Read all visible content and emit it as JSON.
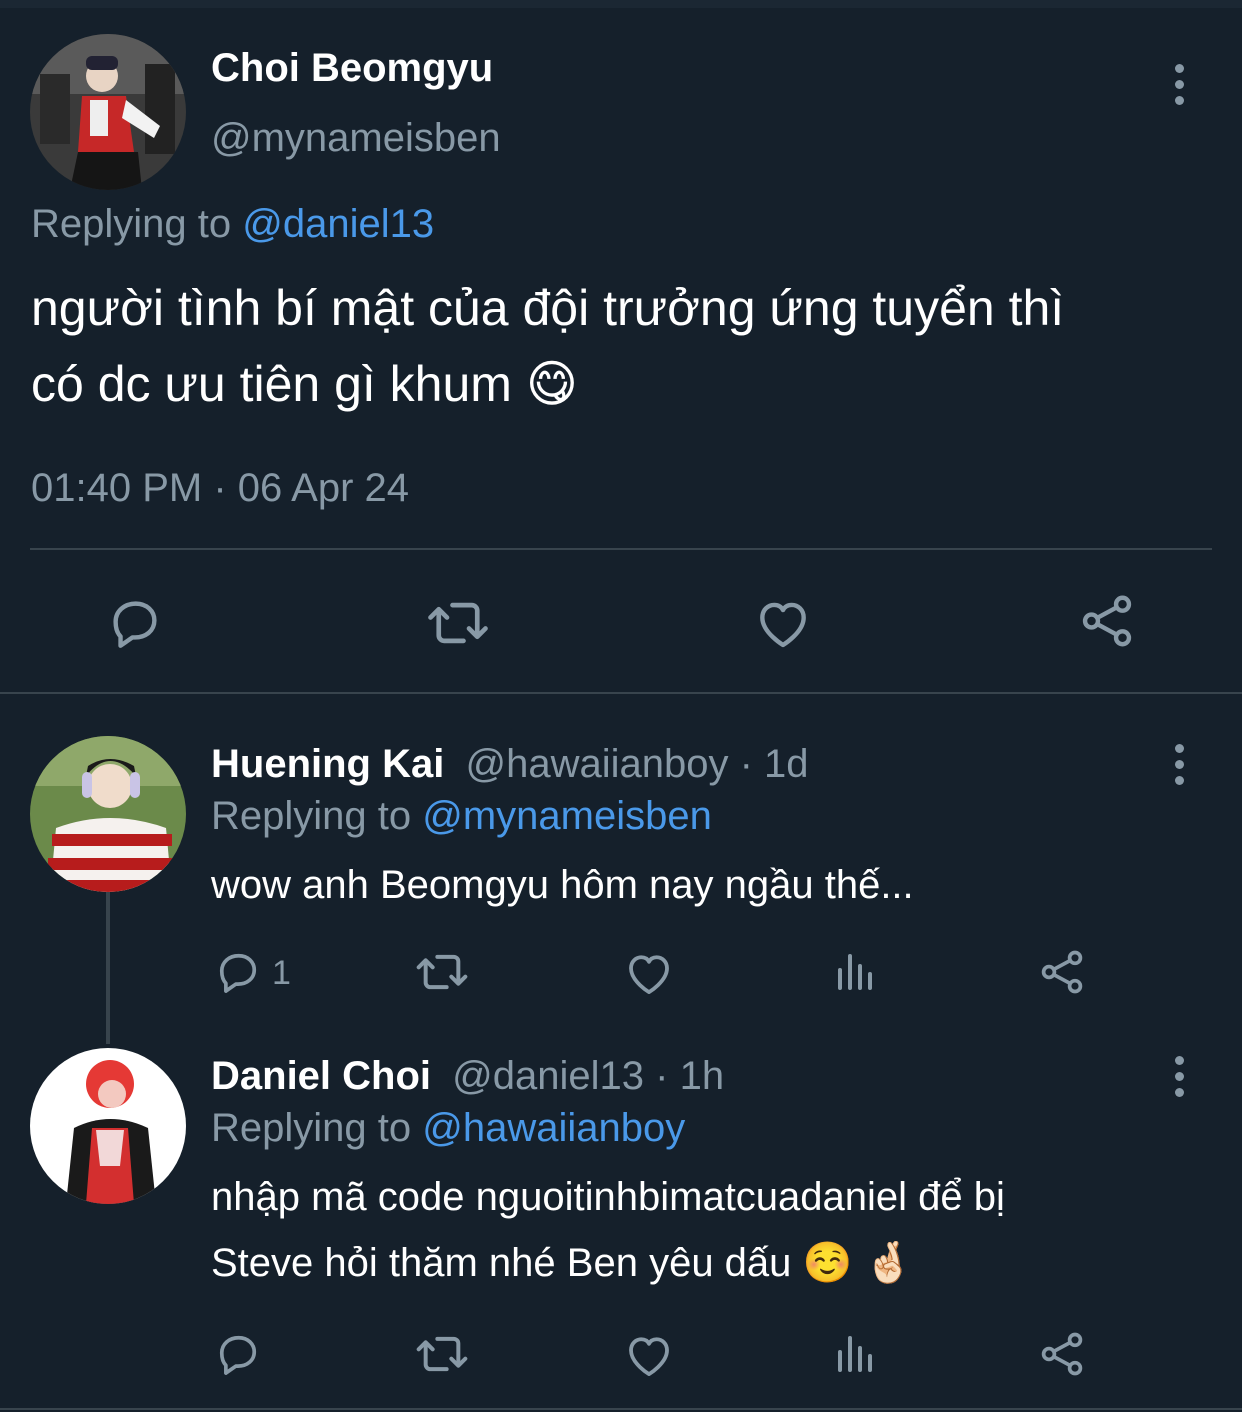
{
  "main_tweet": {
    "author_name": "Choi Beomgyu",
    "author_handle": "@mynameisben",
    "replying_prefix": "Replying to ",
    "replying_to": "@daniel13",
    "text_line1": "người tình bí mật của đội trưởng ứng tuyển thì",
    "text_line2": "có dc ưu tiên gì khum",
    "text_emoji": "😋",
    "timestamp": "01:40 PM · 06 Apr 24",
    "actions": [
      "reply-icon",
      "retweet-icon",
      "like-icon",
      "share-icon"
    ]
  },
  "replies": [
    {
      "author_name": "Huening Kai",
      "author_handle": "@hawaiianboy",
      "time_ago": "· 1d",
      "replying_prefix": "Replying to ",
      "replying_to": "@mynameisben",
      "text_line1": "wow anh Beomgyu hôm nay ngầu thế...",
      "reply_count": "1",
      "actions": [
        "reply-icon",
        "retweet-icon",
        "like-icon",
        "analytics-icon",
        "share-icon"
      ]
    },
    {
      "author_name": "Daniel Choi",
      "author_handle": "@daniel13",
      "time_ago": "· 1h",
      "replying_prefix": "Replying to ",
      "replying_to": "@hawaiianboy",
      "text_line1": "nhập mã code nguoitinhbimatcuadaniel để bị",
      "text_line2": "Steve hỏi thăm nhé Ben yêu dấu",
      "text_emoji": "☺️ 🤞🏻",
      "actions": [
        "reply-icon",
        "retweet-icon",
        "like-icon",
        "analytics-icon",
        "share-icon"
      ]
    }
  ],
  "colors": {
    "background": "#15202b",
    "text": "#ffffff",
    "muted": "#8899a6",
    "link": "#1d9bf0",
    "divider": "#38444d"
  }
}
